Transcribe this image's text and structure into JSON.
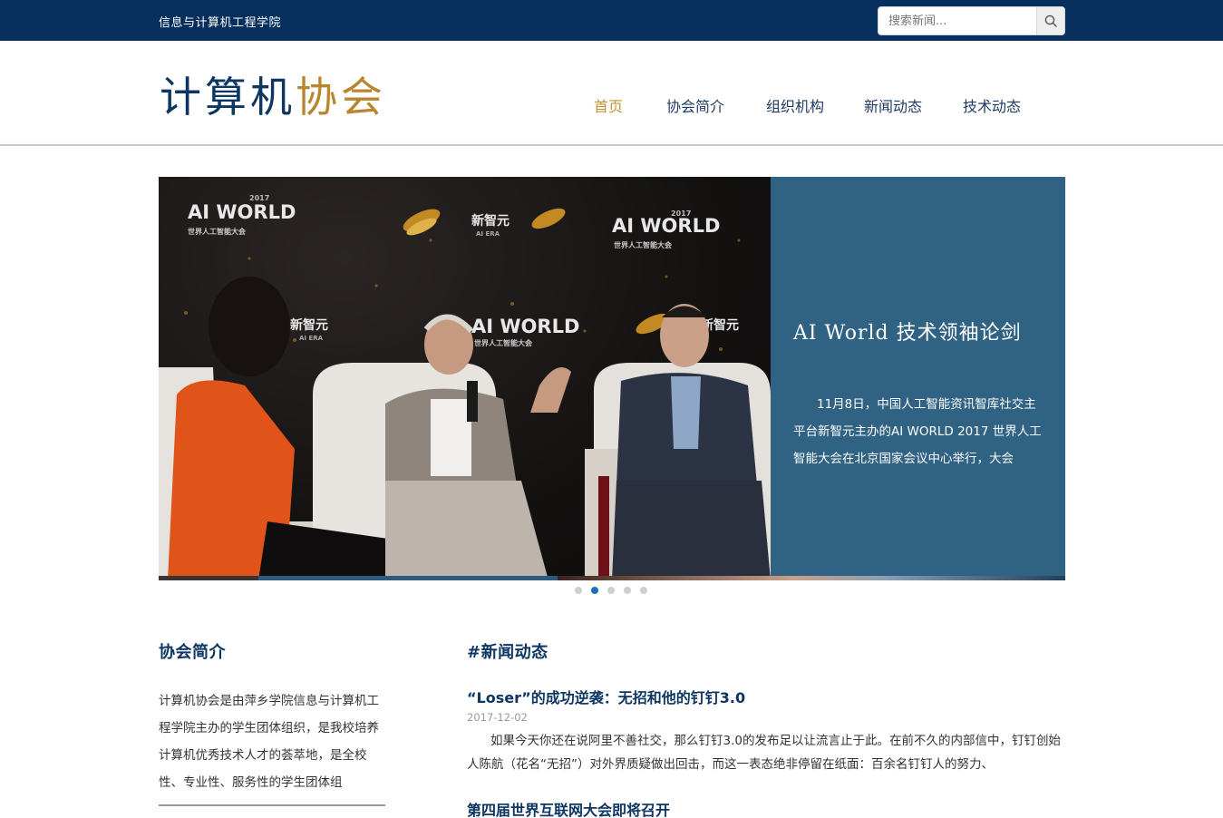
{
  "topbar": {
    "college": "信息与计算机工程学院",
    "search_placeholder": "搜索新闻...",
    "search_icon": "search-icon"
  },
  "header": {
    "logo_part1": "计算机",
    "logo_part2": "协会",
    "nav": [
      "首页",
      "协会简介",
      "组织机构",
      "新闻动态",
      "技术动态"
    ],
    "active_index": 0
  },
  "colors": {
    "topbar_bg": "#062f5e",
    "brand_navy": "#0d3663",
    "brand_gold": "#b8862d",
    "nav_active": "#c39235",
    "slide_panel": "#2f6283",
    "dot_active": "#1e6fb8"
  },
  "slider": {
    "title": "AI World 技术领袖论剑",
    "description": "11月8日，中国人工智能资讯智库社交主平台新智元主办的AI WORLD 2017 世界人工智能大会在北京国家会议中心举行，大会",
    "image_texts": {
      "logo_left": "AI WORLD",
      "year": "2017",
      "sub": "世界人工智能大会",
      "brand": "新智元",
      "brand_small": "AI ERA"
    },
    "dot_count": 5,
    "active_dot": 1
  },
  "about": {
    "title": "协会简介",
    "text": "计算机协会是由萍乡学院信息与计算机工程学院主办的学生团体组织，是我校培养计算机优秀技术人才的荟萃地，是全校性、专业性、服务性的学生团体组"
  },
  "news": {
    "title": "#新闻动态",
    "items": [
      {
        "title": "“Loser”的成功逆袭：无招和他的钉钉3.0",
        "date": "2017-12-02",
        "summary": "如果今天你还在说阿里不善社交，那么钉钉3.0的发布足以让流言止于此。在前不久的内部信中，钉钉创始人陈航（花名“无招”）对外界质疑做出回击，而这一表态绝非停留在纸面：百余名钉钉人的努力、"
      },
      {
        "title": "第四届世界互联网大会即将召开"
      }
    ]
  }
}
